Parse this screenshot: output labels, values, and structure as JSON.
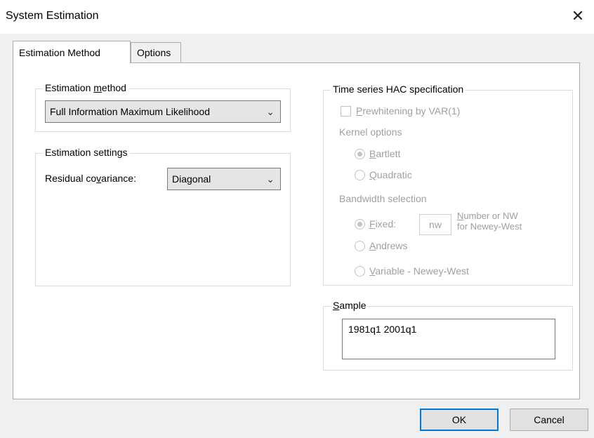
{
  "window": {
    "title": "System Estimation",
    "close_glyph": "✕"
  },
  "tabs": [
    {
      "label": "Estimation Method"
    },
    {
      "label": "Options"
    }
  ],
  "estimation_method": {
    "group_label_pre": "Estimation ",
    "group_label_u": "m",
    "group_label_post": "ethod",
    "selected": "Full Information Maximum Likelihood"
  },
  "estimation_settings": {
    "group_label": "Estimation settings",
    "residual_label_pre": "Residual co",
    "residual_label_u": "v",
    "residual_label_post": "ariance:",
    "residual_selected": "Diagonal"
  },
  "hac": {
    "group_label": "Time series HAC specification",
    "prewhitening_u": "P",
    "prewhitening_rest": "rewhitening by VAR(1)",
    "kernel_label": "Kernel options",
    "bartlett_u": "B",
    "bartlett_rest": "artlett",
    "quadratic_u": "Q",
    "quadratic_rest": "uadratic",
    "bandwidth_label": "Bandwidth selection",
    "fixed_u": "F",
    "fixed_rest": "ixed:",
    "nw_value": "nw",
    "nw_hint_line1_u": "N",
    "nw_hint_line1_rest": "umber or NW",
    "nw_hint_line2": "for Newey-West",
    "andrews_u": "A",
    "andrews_rest": "ndrews",
    "variable_u": "V",
    "variable_rest": "ariable - Newey-West"
  },
  "sample": {
    "group_label_u": "S",
    "group_label_rest": "ample",
    "value": "1981q1 2001q1"
  },
  "buttons": {
    "ok": "OK",
    "cancel": "Cancel"
  }
}
